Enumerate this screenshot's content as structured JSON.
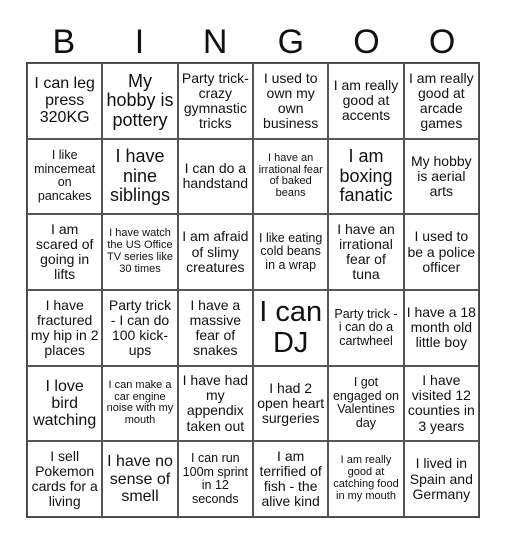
{
  "header": {
    "letters": [
      "B",
      "I",
      "N",
      "G",
      "O",
      "O"
    ]
  },
  "cells": [
    [
      "I can leg press 320KG",
      "My hobby is pottery",
      "Party trick-crazy gymnastic tricks",
      "I used to own my own business",
      "I am really good at accents",
      "I am really good at arcade games"
    ],
    [
      "I like mincemeat on pancakes",
      "I have nine siblings",
      "I can do a handstand",
      "I have an irrational fear of baked beans",
      "I am boxing fanatic",
      "My hobby is aerial arts"
    ],
    [
      "I am scared of going in lifts",
      "I have watch the US Office TV series like 30 times",
      "I am afraid of slimy creatures",
      "I like eating cold beans in a wrap",
      "I have an irrational fear of tuna",
      "I used to be a police officer"
    ],
    [
      "I have fractured my hip in 2 places",
      "Party trick - I can do 100 kick-ups",
      "I have a massive fear of snakes",
      "I can DJ",
      "Party trick - i can do a cartwheel",
      "I have a 18 month old little boy"
    ],
    [
      "I love bird watching",
      "I can make a car engine noise with my mouth",
      "I have had my appendix taken out",
      "I had 2 open heart surgeries",
      "I got engaged on Valentines day",
      "I have visited 12 counties in 3 years"
    ],
    [
      "I sell Pokemon cards for a living",
      "I have no sense of smell",
      "I can run 100m sprint in 12 seconds",
      "I am terrified of fish - the alive kind",
      "I am really good at catching food in my mouth",
      "I lived in Spain and Germany"
    ]
  ]
}
